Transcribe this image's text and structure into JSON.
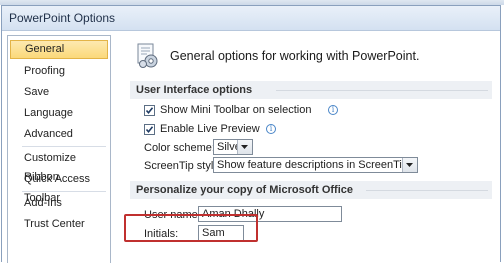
{
  "window": {
    "title": "PowerPoint Options"
  },
  "sidebar": {
    "items": [
      {
        "label": "General"
      },
      {
        "label": "Proofing"
      },
      {
        "label": "Save"
      },
      {
        "label": "Language"
      },
      {
        "label": "Advanced"
      },
      {
        "label": "Customize Ribbon"
      },
      {
        "label": "Quick Access Toolbar"
      },
      {
        "label": "Add-Ins"
      },
      {
        "label": "Trust Center"
      }
    ],
    "selected": "General"
  },
  "header": {
    "text": "General options for working with PowerPoint."
  },
  "ui_options": {
    "title": "User Interface options",
    "mini_toolbar": {
      "label": "Show Mini Toolbar on selection",
      "checked": true
    },
    "live_preview": {
      "label": "Enable Live Preview",
      "checked": true
    },
    "color_scheme": {
      "label": "Color scheme:",
      "value": "Silver"
    },
    "screentip": {
      "label": "ScreenTip style:",
      "value": "Show feature descriptions in ScreenTips"
    }
  },
  "personalize": {
    "title": "Personalize your copy of Microsoft Office",
    "user_name": {
      "label": "User name:",
      "value": "Aman Dhally"
    },
    "initials": {
      "label": "Initials:",
      "value": "Sam"
    }
  },
  "colors": {
    "highlight": "#c0302f",
    "selected_nav": "#fbd97a"
  }
}
